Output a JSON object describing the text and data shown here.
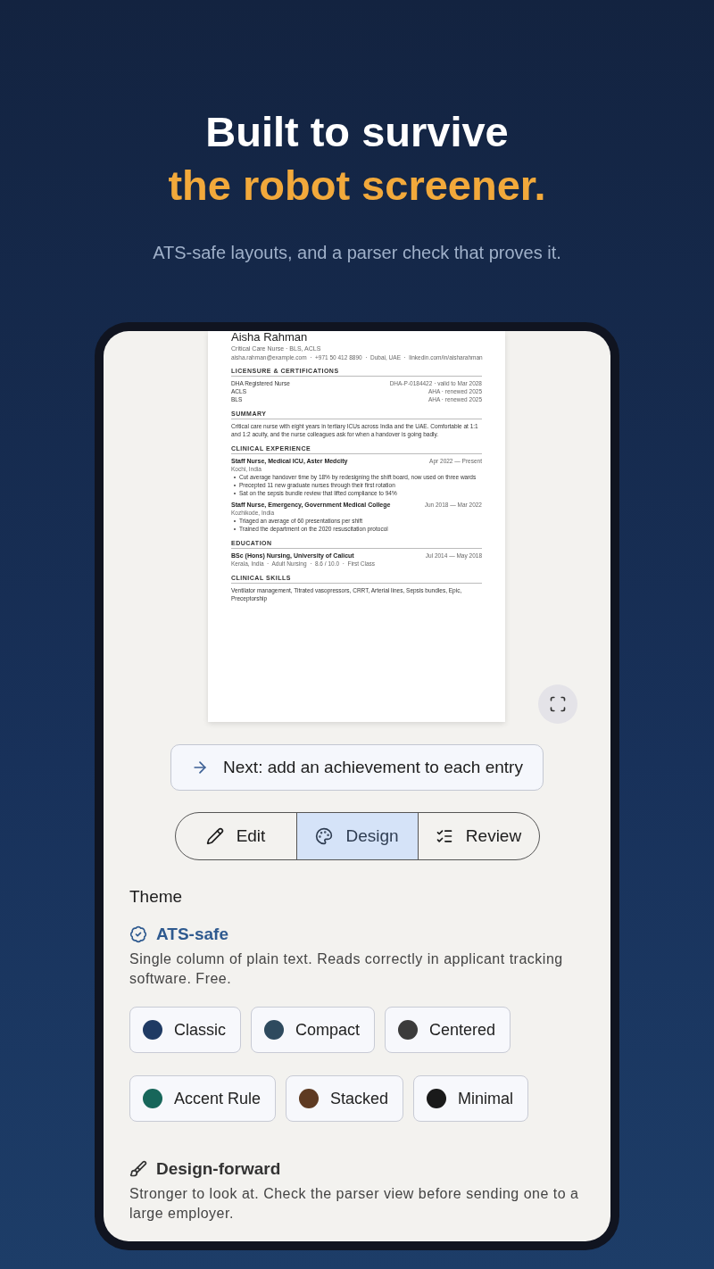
{
  "hero": {
    "title": "Built to survive",
    "highlight": "the robot screener.",
    "subtitle": "ATS-safe layouts, and a parser check that proves it."
  },
  "resume": {
    "name": "Aisha Rahman",
    "headline": "Critical Care Nurse · BLS, ACLS",
    "contact": "aisha.rahman@example.com  ·  +971 50 412 8890  ·  Dubai, UAE  ·  linkedin.com/in/aisharahman",
    "sections": [
      {
        "heading": "LICENSURE & CERTIFICATIONS",
        "kind": "list",
        "items": [
          {
            "left": "DHA Registered Nurse",
            "right": "DHA-P-0184422 · valid to Mar 2028"
          },
          {
            "left": "ACLS",
            "right": "AHA · renewed 2025"
          },
          {
            "left": "BLS",
            "right": "AHA · renewed 2025"
          }
        ]
      },
      {
        "heading": "SUMMARY",
        "kind": "text",
        "text": "Critical care nurse with eight years in tertiary ICUs across India and the UAE. Comfortable at 1:1 and 1:2 acuity, and the nurse colleagues ask for when a handover is going badly."
      },
      {
        "heading": "CLINICAL EXPERIENCE",
        "kind": "entries",
        "entries": [
          {
            "title": "Staff Nurse, Medical ICU, Aster Medcity",
            "date": "Apr 2022 — Present",
            "location": "Kochi, India",
            "bullets": [
              "Cut average handover time by 18% by redesigning the shift board, now used on three wards",
              "Precepted 11 new graduate nurses through their first rotation",
              "Sat on the sepsis bundle review that lifted compliance to 94%"
            ]
          },
          {
            "title": "Staff Nurse, Emergency, Government Medical College",
            "date": "Jun 2018 — Mar 2022",
            "location": "Kozhikode, India",
            "bullets": [
              "Triaged an average of 60 presentations per shift",
              "Trained the department on the 2020 resuscitation protocol"
            ]
          }
        ]
      },
      {
        "heading": "EDUCATION",
        "kind": "entries",
        "entries": [
          {
            "title": "BSc (Hons) Nursing, University of Calicut",
            "date": "Jul 2014 — May 2018",
            "location": "Kerala, India  ·  Adult Nursing  ·  8.6 / 10.0  ·  First Class"
          }
        ]
      },
      {
        "heading": "CLINICAL SKILLS",
        "kind": "text",
        "text": "Ventilator management, Titrated vasopressors, CRRT, Arterial lines, Sepsis bundles, Epic, Preceptorship"
      }
    ]
  },
  "next_step": "Next: add an achievement to each entry",
  "tabs": [
    {
      "label": "Edit",
      "selected": false
    },
    {
      "label": "Design",
      "selected": true
    },
    {
      "label": "Review",
      "selected": false
    }
  ],
  "theme": {
    "label": "Theme",
    "groups": [
      {
        "kind": "ats",
        "title": "ATS-safe",
        "description": "Single column of plain text. Reads correctly in applicant tracking software. Free.",
        "themes": [
          {
            "name": "Classic",
            "color": "#1f3a63"
          },
          {
            "name": "Compact",
            "color": "#2e4a5e"
          },
          {
            "name": "Centered",
            "color": "#3b3b3b"
          },
          {
            "name": "Accent Rule",
            "color": "#17665a"
          },
          {
            "name": "Stacked",
            "color": "#5e3a22"
          },
          {
            "name": "Minimal",
            "color": "#1a1a1a"
          }
        ]
      },
      {
        "kind": "design",
        "title": "Design-forward",
        "description": "Stronger to look at. Check the parser view before sending one to a large employer."
      }
    ]
  }
}
